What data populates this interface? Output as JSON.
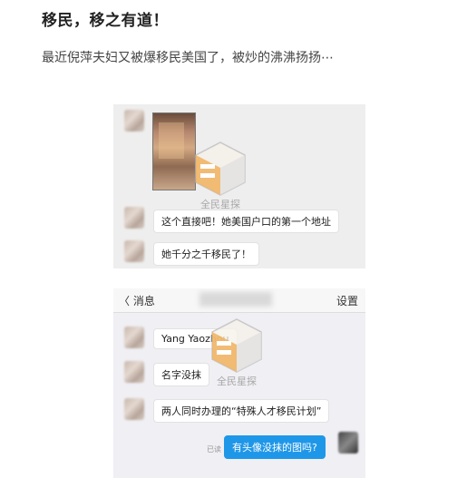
{
  "article": {
    "title": "移民，移之有道！",
    "subtitle": "最近倪萍夫妇又被爆移民美国了，被炒的沸沸扬扬⋯"
  },
  "screenshot1": {
    "messages": [
      {
        "text": "这个直接吧！她美国户口的第一个地址",
        "side": "left"
      },
      {
        "text": "她千分之千移民了！",
        "side": "left"
      }
    ],
    "watermark": "全民星探"
  },
  "screenshot2": {
    "nav": {
      "back": "〈 消息",
      "settings": "设置"
    },
    "messages": [
      {
        "text": "Yang Yaozhou",
        "side": "left"
      },
      {
        "text": "名字没抹",
        "side": "left"
      },
      {
        "text": "两人同时办理的“特殊人才移民计划”",
        "side": "left"
      },
      {
        "text": "有头像没抹的图吗?",
        "side": "right"
      }
    ],
    "status": "已读",
    "watermark": "全民星探"
  },
  "colors": {
    "self_bubble": "#1f97e8",
    "chat_bg": "#eeeeee"
  },
  "icons": [
    "avatar-blurred",
    "watermark-logo",
    "back-chevron-icon"
  ]
}
